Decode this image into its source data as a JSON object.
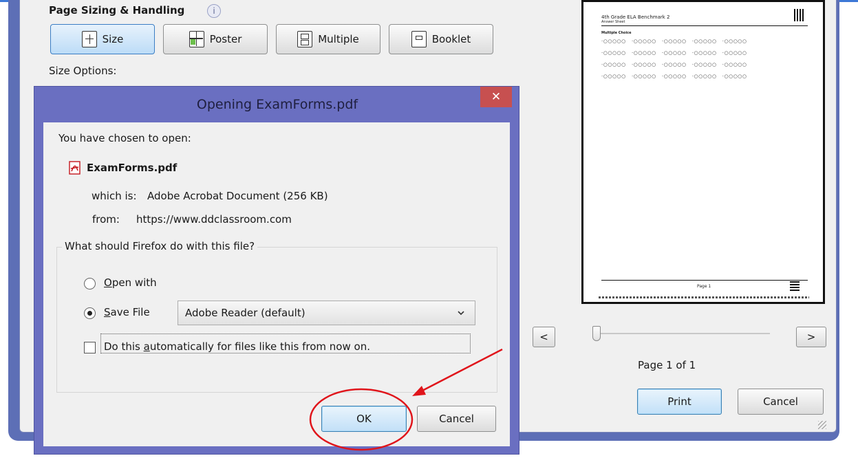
{
  "print_dialog": {
    "section_title": "Page Sizing & Handling",
    "info_glyph": "i",
    "buttons": [
      {
        "label": "Size",
        "icon": "size-icon",
        "active": true
      },
      {
        "label": "Poster",
        "icon": "poster-icon",
        "active": false
      },
      {
        "label": "Multiple",
        "icon": "multiple-icon",
        "active": false
      },
      {
        "label": "Booklet",
        "icon": "booklet-icon",
        "active": false
      }
    ],
    "size_options_label": "Size Options:",
    "prev_label": "<",
    "next_label": ">",
    "page_indicator": "Page 1 of 1",
    "print_label": "Print",
    "cancel_label": "Cancel",
    "preview": {
      "title_line": "4th Grade ELA Benchmark 2",
      "sub_line": "Answer Sheet",
      "section_label": "Multiple Choice",
      "footer_label": "Page 1"
    }
  },
  "download_dialog": {
    "title": "Opening ExamForms.pdf",
    "close_glyph": "✕",
    "intro": "You have chosen to open:",
    "file_name": "ExamForms.pdf",
    "which_is_label": "which is:",
    "which_is_value": "Adobe Acrobat Document (256 KB)",
    "from_label": "from:",
    "from_value": "https://www.ddclassroom.com",
    "question": "What should Firefox do with this file?",
    "open_with_label": "Open with",
    "open_with_app": "Adobe Reader  (default)",
    "save_file_label": "Save File",
    "auto_label": "Do this automatically for files like this from now on.",
    "ok_label": "OK",
    "cancel_label": "Cancel",
    "selected_option": "save",
    "auto_checked": false
  },
  "annotation": {
    "color": "#e0151b"
  },
  "colors": {
    "dialog_frame": "#6a6fc1",
    "print_frame": "#5d6fb6",
    "close_red": "#c75050"
  }
}
